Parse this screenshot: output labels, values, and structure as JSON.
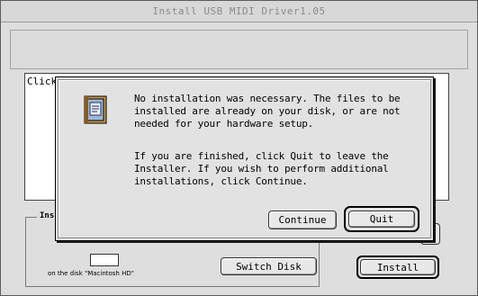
{
  "window": {
    "title": "Install USB MIDI Driver1.05"
  },
  "main": {
    "text_area_partial": "Click"
  },
  "install_group": {
    "legend_partial": "Ins",
    "disk_label": "on the disk \"Macintosh HD\"",
    "switch_disk_label": "Switch Disk",
    "install_label": "Install"
  },
  "alert": {
    "icon": "installer-icon",
    "message_1": "No installation was necessary. The files to be installed are already on your disk, or are not needed for your hardware setup.",
    "message_2": "If you are finished, click Quit to leave the Installer. If you wish to perform additional installations, click Continue.",
    "continue_label": "Continue",
    "quit_label": "Quit"
  }
}
